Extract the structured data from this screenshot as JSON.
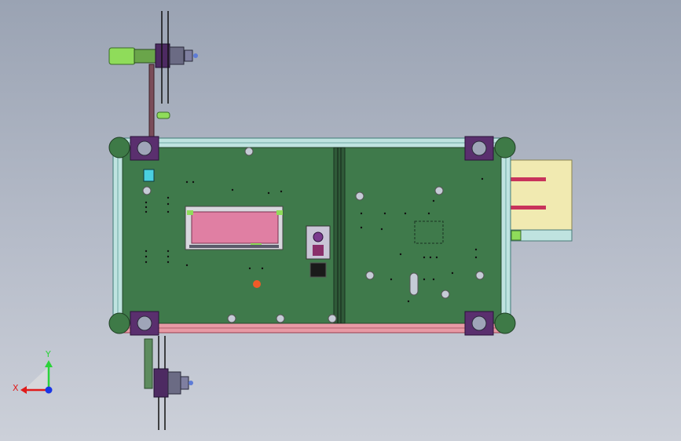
{
  "scene": {
    "background_top": "#9aa3b3",
    "background_bottom": "#ccd0d9",
    "pcb_color": "#3f7a4b",
    "frame_top_color": "#bfe3e0",
    "frame_bottom_color": "#e89aa5",
    "display_color": "#e07fa3",
    "connector_color": "#f1eab1",
    "bracket_color": "#5a2f6e",
    "motor_color": "#8fdc5a"
  },
  "triad": {
    "x_label": "X",
    "y_label": "Y",
    "x_color": "#e01b1b",
    "y_color": "#2bd33a",
    "z_color": "#1936e6"
  }
}
